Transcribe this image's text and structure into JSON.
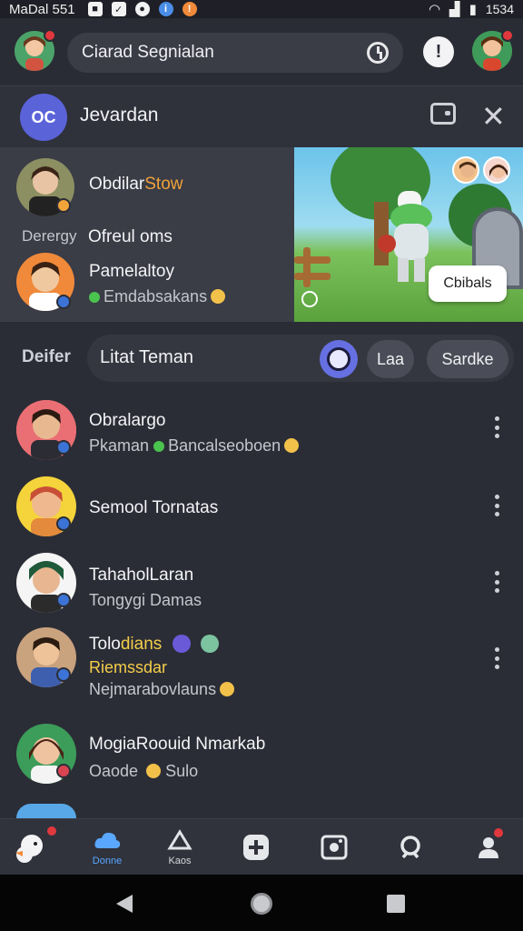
{
  "status_bar": {
    "carrier": "MaDal 551",
    "time": "1534"
  },
  "header": {
    "search_text": "Ciarad Segnialan"
  },
  "server": {
    "logo_text": "OC",
    "title": "Jevardan"
  },
  "featured": {
    "item1": {
      "name_a": "Obdilar",
      "name_b": "Stow"
    },
    "caption_label": "Derergy",
    "caption_value": "Ofreul oms",
    "item2": {
      "name": "Pamelaltoy",
      "status": "Emdabsakans"
    },
    "scene_label": "Cbibals"
  },
  "filter": {
    "section_label": "Deifer",
    "title": "Litat Teman",
    "chip1": "Laa",
    "chip2": "Sardke"
  },
  "friends": [
    {
      "name": "Obralargo",
      "status_a": "Pkaman",
      "status_b": "Bancalseoboen"
    },
    {
      "name": "Semool Tornatas"
    },
    {
      "name": "TahaholLaran",
      "status_a": "Tongygi Damas"
    },
    {
      "name_a": "Tolo",
      "name_b": "dians",
      "status_a": "Riemssdar",
      "status_b": "Nejmarabovlauns"
    },
    {
      "name": "MogiaRoouid Nmarkab",
      "status_a": "Oaode",
      "status_b": "Sulo"
    }
  ],
  "bottom_nav": {
    "home": "Donne",
    "explore": "Kaos"
  },
  "colors": {
    "accent_blue": "#5aa7ff",
    "server_purple": "#5a63d8",
    "notification_red": "#e0383d",
    "status_blue": "#3b73d6"
  }
}
